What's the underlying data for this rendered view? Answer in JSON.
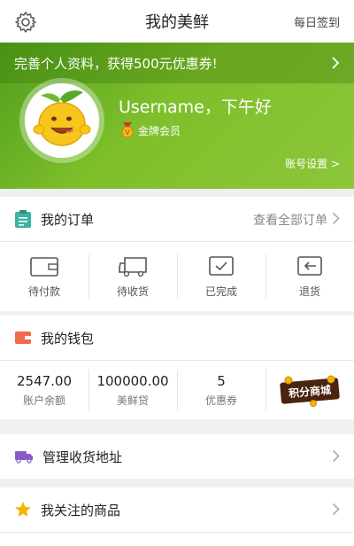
{
  "header": {
    "title": "我的美鲜",
    "checkin_label": "每日签到"
  },
  "profile": {
    "promo_text": "完善个人资料，获得500元优惠券!",
    "greeting": "Username，下午好",
    "member_level": "金牌会员",
    "account_settings": "账号设置 >"
  },
  "orders": {
    "title": "我的订单",
    "view_all": "查看全部订单",
    "items": [
      {
        "label": "待付款",
        "icon": "wallet-icon"
      },
      {
        "label": "待收货",
        "icon": "truck-icon"
      },
      {
        "label": "已完成",
        "icon": "check-box-icon"
      },
      {
        "label": "退货",
        "icon": "return-icon"
      }
    ]
  },
  "wallet": {
    "title": "我的钱包",
    "items": [
      {
        "value": "2547.00",
        "label": "账户余额"
      },
      {
        "value": "100000.00",
        "label": "美鲜贷"
      },
      {
        "value": "5",
        "label": "优惠券"
      }
    ],
    "points_mall": "积分商城"
  },
  "address": {
    "label": "管理收货地址"
  },
  "favorites": {
    "label": "我关注的商品"
  },
  "colors": {
    "accent_green": "#7fbf2a",
    "icon_teal": "#3bb3a3",
    "wallet_red": "#f26a4b",
    "truck_purple": "#8a5bc7",
    "star_yellow": "#f5b400"
  }
}
